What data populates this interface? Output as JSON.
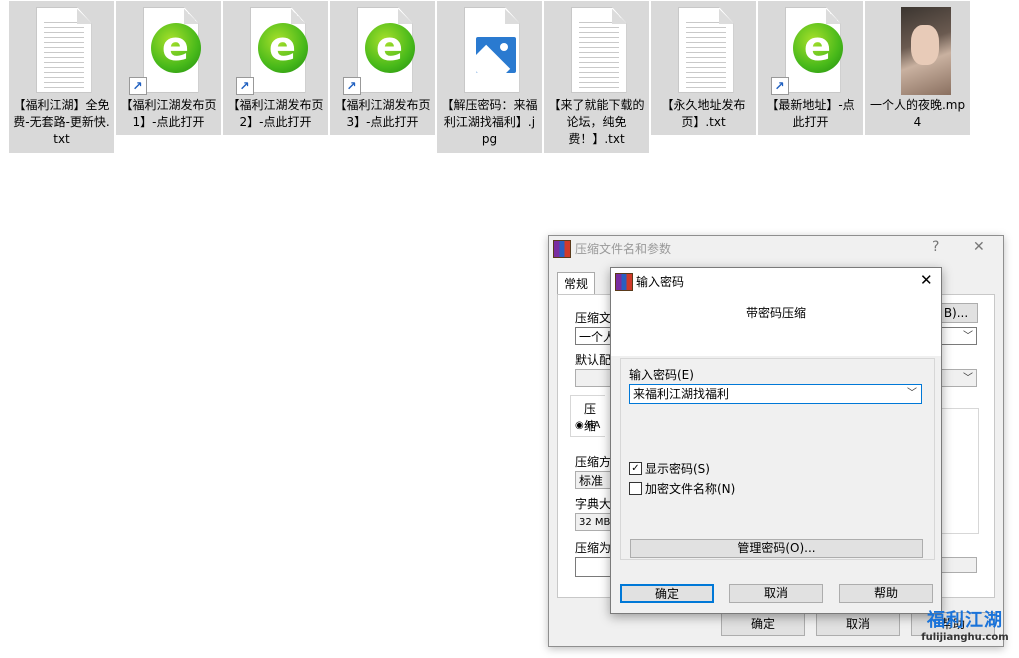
{
  "files": [
    {
      "type": "txt",
      "name": "【福利江湖】全免费-无套路-更新快.txt",
      "shortcut": false
    },
    {
      "type": "ie",
      "name": "【福利江湖发布页1】-点此打开",
      "shortcut": true
    },
    {
      "type": "ie",
      "name": "【福利江湖发布页2】-点此打开",
      "shortcut": true
    },
    {
      "type": "ie",
      "name": "【福利江湖发布页3】-点此打开",
      "shortcut": true
    },
    {
      "type": "jpg",
      "name": "【解压密码：来福利江湖找福利】.jpg",
      "shortcut": false
    },
    {
      "type": "txt",
      "name": "【来了就能下载的论坛，纯免费！】.txt",
      "shortcut": false
    },
    {
      "type": "txt",
      "name": "【永久地址发布页】.txt",
      "shortcut": false
    },
    {
      "type": "ie",
      "name": "【最新地址】-点此打开",
      "shortcut": true
    },
    {
      "type": "mp4",
      "name": "一个人的夜晚.mp4",
      "shortcut": false
    }
  ],
  "back_dialog": {
    "title": "压缩文件名和参数",
    "help_glyph": "?",
    "close_glyph": "✕",
    "tab_general": "常规",
    "archive_name_label": "压缩文",
    "archive_name_value": "一个人",
    "default_profile_label": "默认配",
    "browse_button": "B)...",
    "format_label": "压缩",
    "format_rar": "RA",
    "method_label": "压缩方",
    "method_value": "标准",
    "dict_label": "字典大",
    "dict_value": "32 MB",
    "split_label": "压缩为",
    "ok": "确定",
    "cancel": "取消",
    "help": "帮助"
  },
  "front_dialog": {
    "title": "输入密码",
    "close_glyph": "✕",
    "heading": "带密码压缩",
    "password_label": "输入密码(E)",
    "password_value": "来福利江湖找福利",
    "show_password_label": "显示密码(S)",
    "show_password_checked": true,
    "encrypt_names_label": "加密文件名称(N)",
    "encrypt_names_checked": false,
    "manage_button": "管理密码(O)...",
    "ok": "确定",
    "cancel": "取消",
    "help": "帮助"
  },
  "watermark": {
    "main": "福利江湖",
    "url": "fulijianghu.com"
  }
}
